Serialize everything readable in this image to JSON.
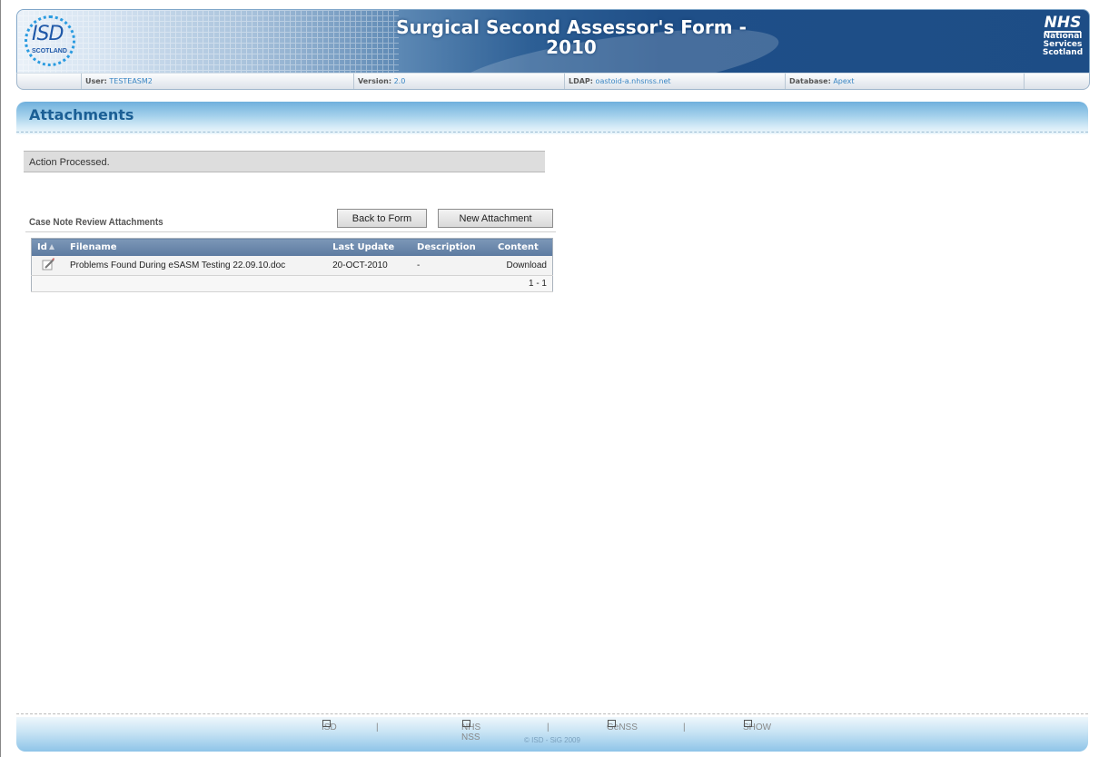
{
  "header": {
    "title_line1": "Surgical Second Assessor's Form -",
    "title_line2": "2010",
    "isd_logo_text": "ISD",
    "isd_logo_sub": "SCOTLAND",
    "nhs_logo": "NHS",
    "nhs_sub1": "National",
    "nhs_sub2": "Services",
    "nhs_sub3": "Scotland"
  },
  "infobar": {
    "user_label": "User:",
    "user_value": "TESTEASM2",
    "version_label": "Version:",
    "version_value": "2.0",
    "ldap_label": "LDAP:",
    "ldap_value": "oastoid-a.nhsnss.net",
    "database_label": "Database:",
    "database_value": "Apext"
  },
  "region": {
    "title": "Attachments",
    "message": "Action Processed.",
    "subregion_title": "Case Note Review Attachments",
    "back_button": "Back to Form",
    "new_button": "New Attachment"
  },
  "table": {
    "columns": [
      "Id",
      "Filename",
      "Last Update",
      "Description",
      "Content"
    ],
    "rows": [
      {
        "filename": "Problems Found During eSASM Testing 22.09.10.doc",
        "last_update": "20-OCT-2010",
        "description": "-",
        "content": "Download"
      }
    ],
    "pagination": "1 - 1"
  },
  "footer": {
    "links": [
      "ISD",
      "NHS NSS",
      "GeNSS",
      "SHOW"
    ],
    "separator": "|",
    "copyright": "© ISD - SiG 2009"
  }
}
